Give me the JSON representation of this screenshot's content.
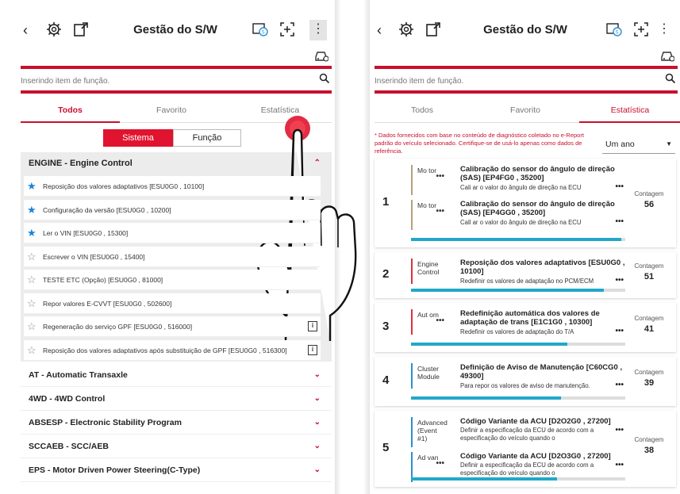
{
  "header": {
    "title": "Gestão do S/W",
    "back_glyph": "‹",
    "menu_glyph": "⋮"
  },
  "search": {
    "placeholder": "Inserindo item de função."
  },
  "tabs": {
    "all": "Todos",
    "favorite": "Favorito",
    "statistics": "Estatística"
  },
  "segments": {
    "system": "Sistema",
    "function": "Função"
  },
  "left": {
    "engine_group": "ENGINE - Engine Control",
    "items": [
      {
        "label": "Reposição dos valores adaptativos [ESU0G0 , 10100]",
        "star": "filled",
        "doc": false
      },
      {
        "label": "Configuração da versão [ESU0G0 , 10200]",
        "star": "filled",
        "doc": false
      },
      {
        "label": "Ler o VIN [ESU0G0 , 15300]",
        "star": "filled",
        "doc": false
      },
      {
        "label": "Escrever o VIN [ESU0G0 , 15400]",
        "star": "empty",
        "doc": false
      },
      {
        "label": "TESTE ETC (Opção) [ESU0G0 , 81000]",
        "star": "empty",
        "doc": false
      },
      {
        "label": "Repor valores E-CVVT [ESU0G0 , 502600]",
        "star": "empty",
        "doc": false
      },
      {
        "label": "Regeneração do serviço GPF [ESU0G0 , 516000]",
        "star": "empty",
        "doc": true
      },
      {
        "label": "Reposição dos valores adaptativos após substituição de GPF [ESU0G0 , 516300]",
        "star": "empty",
        "doc": true
      }
    ],
    "categories": [
      "AT - Automatic Transaxle",
      "4WD - 4WD Control",
      "ABSESP - Electronic Stability Program",
      "SCCAEB - SCC/AEB",
      "EPS - Motor Driven Power Steering(C-Type)"
    ]
  },
  "stats": {
    "note": "* Dados fornecidos com base no conteúdo de diagnóstico coletado no e-Report padrão do veículo selecionado. Certifique-se de usá-lo apenas como dados de referência.",
    "period": "Um ano",
    "count_label": "Contagem",
    "cards": [
      {
        "rank": "1",
        "count": "56",
        "bar": 0.98,
        "entries": [
          {
            "cat": "Mo tor",
            "title": "Calibração do sensor do ângulo de direção (SAS) [EP4FG0 , 35200]",
            "desc": "Cali ar o valor do ângulo de direção na ECU"
          },
          {
            "cat": "Mo tor",
            "title": "Calibração do sensor do ângulo de direção (SAS) [EP4GG0 , 35200]",
            "desc": "Call ar o valor do ângulo de direção na ECU"
          }
        ]
      },
      {
        "rank": "2",
        "count": "51",
        "bar": 0.9,
        "entries": [
          {
            "cat": "Engine Control",
            "title": "Reposição dos valores adaptativos [ESU0G0 , 10100]",
            "desc": "Redefinir os valores de adaptação no PCM/ECM"
          }
        ]
      },
      {
        "rank": "3",
        "count": "41",
        "bar": 0.73,
        "entries": [
          {
            "cat": "Aut om",
            "title": "Redefinição automática dos valores de adaptação de trans [E1C1G0 , 10300]",
            "desc": "Redefinir os valores de adaptação do T/A"
          }
        ]
      },
      {
        "rank": "4",
        "count": "39",
        "bar": 0.7,
        "entries": [
          {
            "cat": "Cluster Module",
            "title": "Definição de Aviso de Manutenção [C60CG0 , 49300]",
            "desc": "Para repor os valores de aviso de manutenção."
          }
        ]
      },
      {
        "rank": "5",
        "count": "38",
        "bar": 0.68,
        "entries": [
          {
            "cat": "Advanced (Event #1)",
            "title": "Código Variante da ACU [D2O2G0 , 27200]",
            "desc": "Definir a especificação da ECU de acordo com a especificação do veículo quando o"
          },
          {
            "cat": "Ad van",
            "title": "Código Variante da ACU [D2O3G0 , 27200]",
            "desc": "Definir a especificação da ECU de acordo com a especificação do veículo quando o"
          }
        ]
      }
    ]
  },
  "colors": {
    "accent": "#c8102e",
    "star": "#1a84d6",
    "bar": "#21a8c8"
  },
  "icons": [
    "back-icon",
    "gear-icon",
    "export-icon",
    "sw-icon",
    "scan-icon",
    "menu-icon",
    "car-icon",
    "search-icon",
    "star-icon",
    "document-icon",
    "chevron-icon",
    "hand-gesture"
  ]
}
